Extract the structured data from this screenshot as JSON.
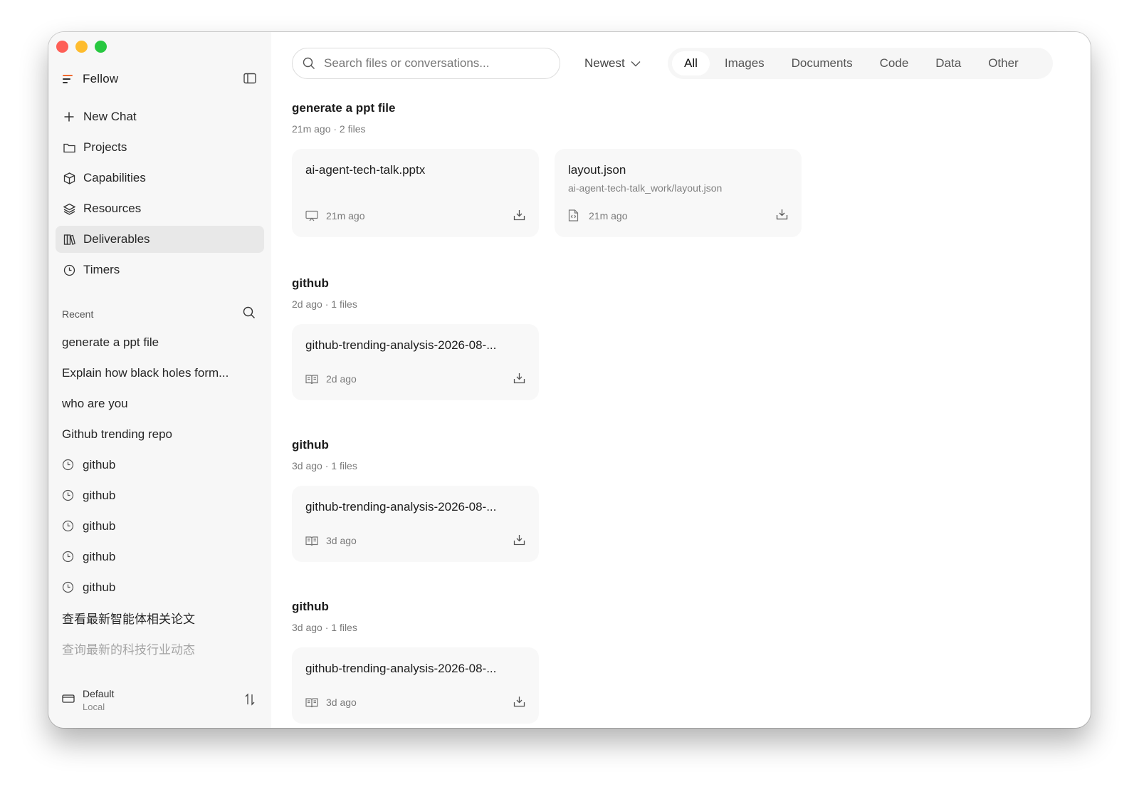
{
  "app": {
    "name": "Fellow"
  },
  "nav": [
    {
      "label": "New Chat",
      "icon": "plus-icon"
    },
    {
      "label": "Projects",
      "icon": "folder-icon"
    },
    {
      "label": "Capabilities",
      "icon": "cube-icon"
    },
    {
      "label": "Resources",
      "icon": "layers-icon"
    },
    {
      "label": "Deliverables",
      "icon": "books-icon",
      "active": true
    },
    {
      "label": "Timers",
      "icon": "clock-icon"
    }
  ],
  "recent": {
    "heading": "Recent",
    "items": [
      {
        "label": "generate a ppt file"
      },
      {
        "label": "Explain how black holes form..."
      },
      {
        "label": "who are you"
      },
      {
        "label": "Github trending repo"
      },
      {
        "label": "github",
        "icon": "clock-icon"
      },
      {
        "label": "github",
        "icon": "clock-icon"
      },
      {
        "label": "github",
        "icon": "clock-icon"
      },
      {
        "label": "github",
        "icon": "clock-icon"
      },
      {
        "label": "github",
        "icon": "clock-icon"
      },
      {
        "label": "查看最新智能体相关论文"
      },
      {
        "label": "查询最新的科技行业动态",
        "faded": true
      }
    ]
  },
  "workspace": {
    "name": "Default",
    "location": "Local"
  },
  "search": {
    "placeholder": "Search files or conversations..."
  },
  "sort": {
    "label": "Newest"
  },
  "filters": [
    "All",
    "Images",
    "Documents",
    "Code",
    "Data",
    "Other"
  ],
  "groups": [
    {
      "title": "generate a ppt file",
      "meta": "21m ago · 2 files",
      "files": [
        {
          "name": "ai-agent-tech-talk.pptx",
          "path": "",
          "time": "21m ago",
          "icon": "slides-icon"
        },
        {
          "name": "layout.json",
          "path": "ai-agent-tech-talk_work/layout.json",
          "time": "21m ago",
          "icon": "code-file-icon"
        }
      ]
    },
    {
      "title": "github",
      "meta": "2d ago · 1 files",
      "files": [
        {
          "name": "github-trending-analysis-2026-08-...",
          "time": "2d ago",
          "icon": "book-icon"
        }
      ]
    },
    {
      "title": "github",
      "meta": "3d ago · 1 files",
      "files": [
        {
          "name": "github-trending-analysis-2026-08-...",
          "time": "3d ago",
          "icon": "book-icon"
        }
      ]
    },
    {
      "title": "github",
      "meta": "3d ago · 1 files",
      "files": [
        {
          "name": "github-trending-analysis-2026-08-...",
          "time": "3d ago",
          "icon": "book-icon"
        }
      ]
    }
  ]
}
